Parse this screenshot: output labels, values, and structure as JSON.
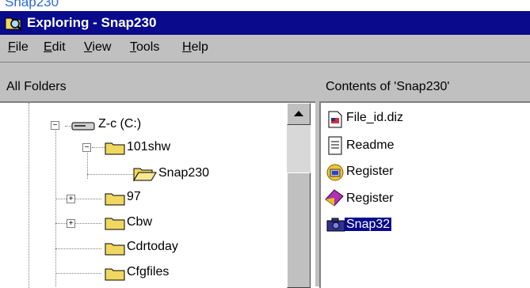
{
  "window": {
    "top_fragment": "Snap230",
    "title": "Exploring - Snap230"
  },
  "menu": {
    "items": [
      {
        "label": "File",
        "ul": "F"
      },
      {
        "label": "Edit",
        "ul": "E"
      },
      {
        "label": "View",
        "ul": "V"
      },
      {
        "label": "Tools",
        "ul": "T"
      },
      {
        "label": "Help",
        "ul": "H"
      }
    ]
  },
  "left_pane": {
    "header": "All Folders",
    "tree": [
      {
        "label": "Z-c (C:)",
        "icon": "drive-icon",
        "expander": "minus"
      },
      {
        "label": "101shw",
        "icon": "folder-icon",
        "expander": "minus"
      },
      {
        "label": "Snap230",
        "icon": "open-folder-icon",
        "expander": "none"
      },
      {
        "label": "97",
        "icon": "folder-icon",
        "expander": "plus"
      },
      {
        "label": "Cbw",
        "icon": "folder-icon",
        "expander": "plus"
      },
      {
        "label": "Cdrtoday",
        "icon": "folder-icon",
        "expander": "none"
      },
      {
        "label": "Cfgfiles",
        "icon": "folder-icon",
        "expander": "none"
      }
    ]
  },
  "right_pane": {
    "header": "Contents of 'Snap230'",
    "files": [
      {
        "label": "File_id.diz",
        "icon": "image-file-icon"
      },
      {
        "label": "Readme",
        "icon": "text-file-icon"
      },
      {
        "label": "Register",
        "icon": "setup-icon"
      },
      {
        "label": "Register",
        "icon": "gem-icon"
      },
      {
        "label": "Snap32",
        "icon": "camera-icon",
        "selected": true
      }
    ]
  },
  "colors": {
    "title_bar": "#0a0a8c",
    "chrome": "#c0c0c0",
    "selection": "#0a0a8c",
    "folder": "#f0d860"
  }
}
